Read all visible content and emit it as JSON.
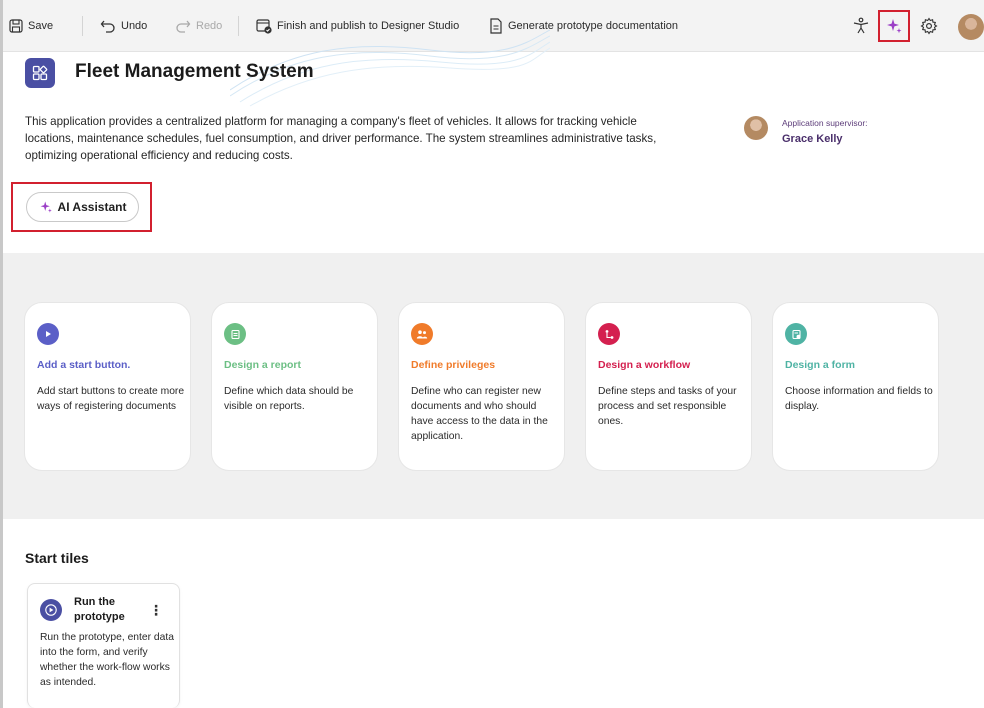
{
  "toolbar": {
    "save_label": "Save",
    "undo_label": "Undo",
    "redo_label": "Redo",
    "publish_label": "Finish and publish to Designer Studio",
    "docs_label": "Generate prototype documentation",
    "icons": [
      "save-icon",
      "undo-icon",
      "redo-icon",
      "publish-icon",
      "document-icon",
      "accessibility-icon",
      "sparkle-icon",
      "gear-icon",
      "user-avatar"
    ]
  },
  "app": {
    "title": "Fleet Management System",
    "description": "This application provides a centralized platform for managing a company's fleet of vehicles.  It allows for tracking vehicle locations, maintenance schedules, fuel consumption, and driver performance.  The system streamlines administrative tasks, optimizing operational efficiency and reducing costs.",
    "supervisor_label": "Application supervisor:",
    "supervisor_name": "Grace Kelly"
  },
  "ai_assistant": {
    "label": "AI Assistant"
  },
  "cards": [
    {
      "title": "Add a start button.",
      "text": "Add start buttons to create more ways of registering documents",
      "color": "#5b5fc7",
      "icon": "play-icon"
    },
    {
      "title": "Design a report",
      "text": "Define which data should be visible on reports.",
      "color": "#6cbf84",
      "icon": "report-icon"
    },
    {
      "title": "Define privileges",
      "text": "Define who can register new documents and who should have access to the data in the application.",
      "color": "#f07b2a",
      "icon": "users-icon"
    },
    {
      "title": "Design a workflow",
      "text": "Define steps and tasks of your process and set responsible ones.",
      "color": "#d4204f",
      "icon": "workflow-icon"
    },
    {
      "title": "Design a form",
      "text": "Choose information and fields to display.",
      "color": "#4fb3a4",
      "icon": "form-icon"
    }
  ],
  "start_tiles": {
    "heading": "Start tiles",
    "tiles": [
      {
        "title": "Run the prototype",
        "text": "Run the prototype, enter data into the form, and verify whether the work-flow works as intended.",
        "menu": "⋮"
      }
    ]
  },
  "colors": {
    "accent": "#4a4fa3",
    "highlight_border": "#d2202f",
    "sparkle": "#9b3fc6"
  }
}
